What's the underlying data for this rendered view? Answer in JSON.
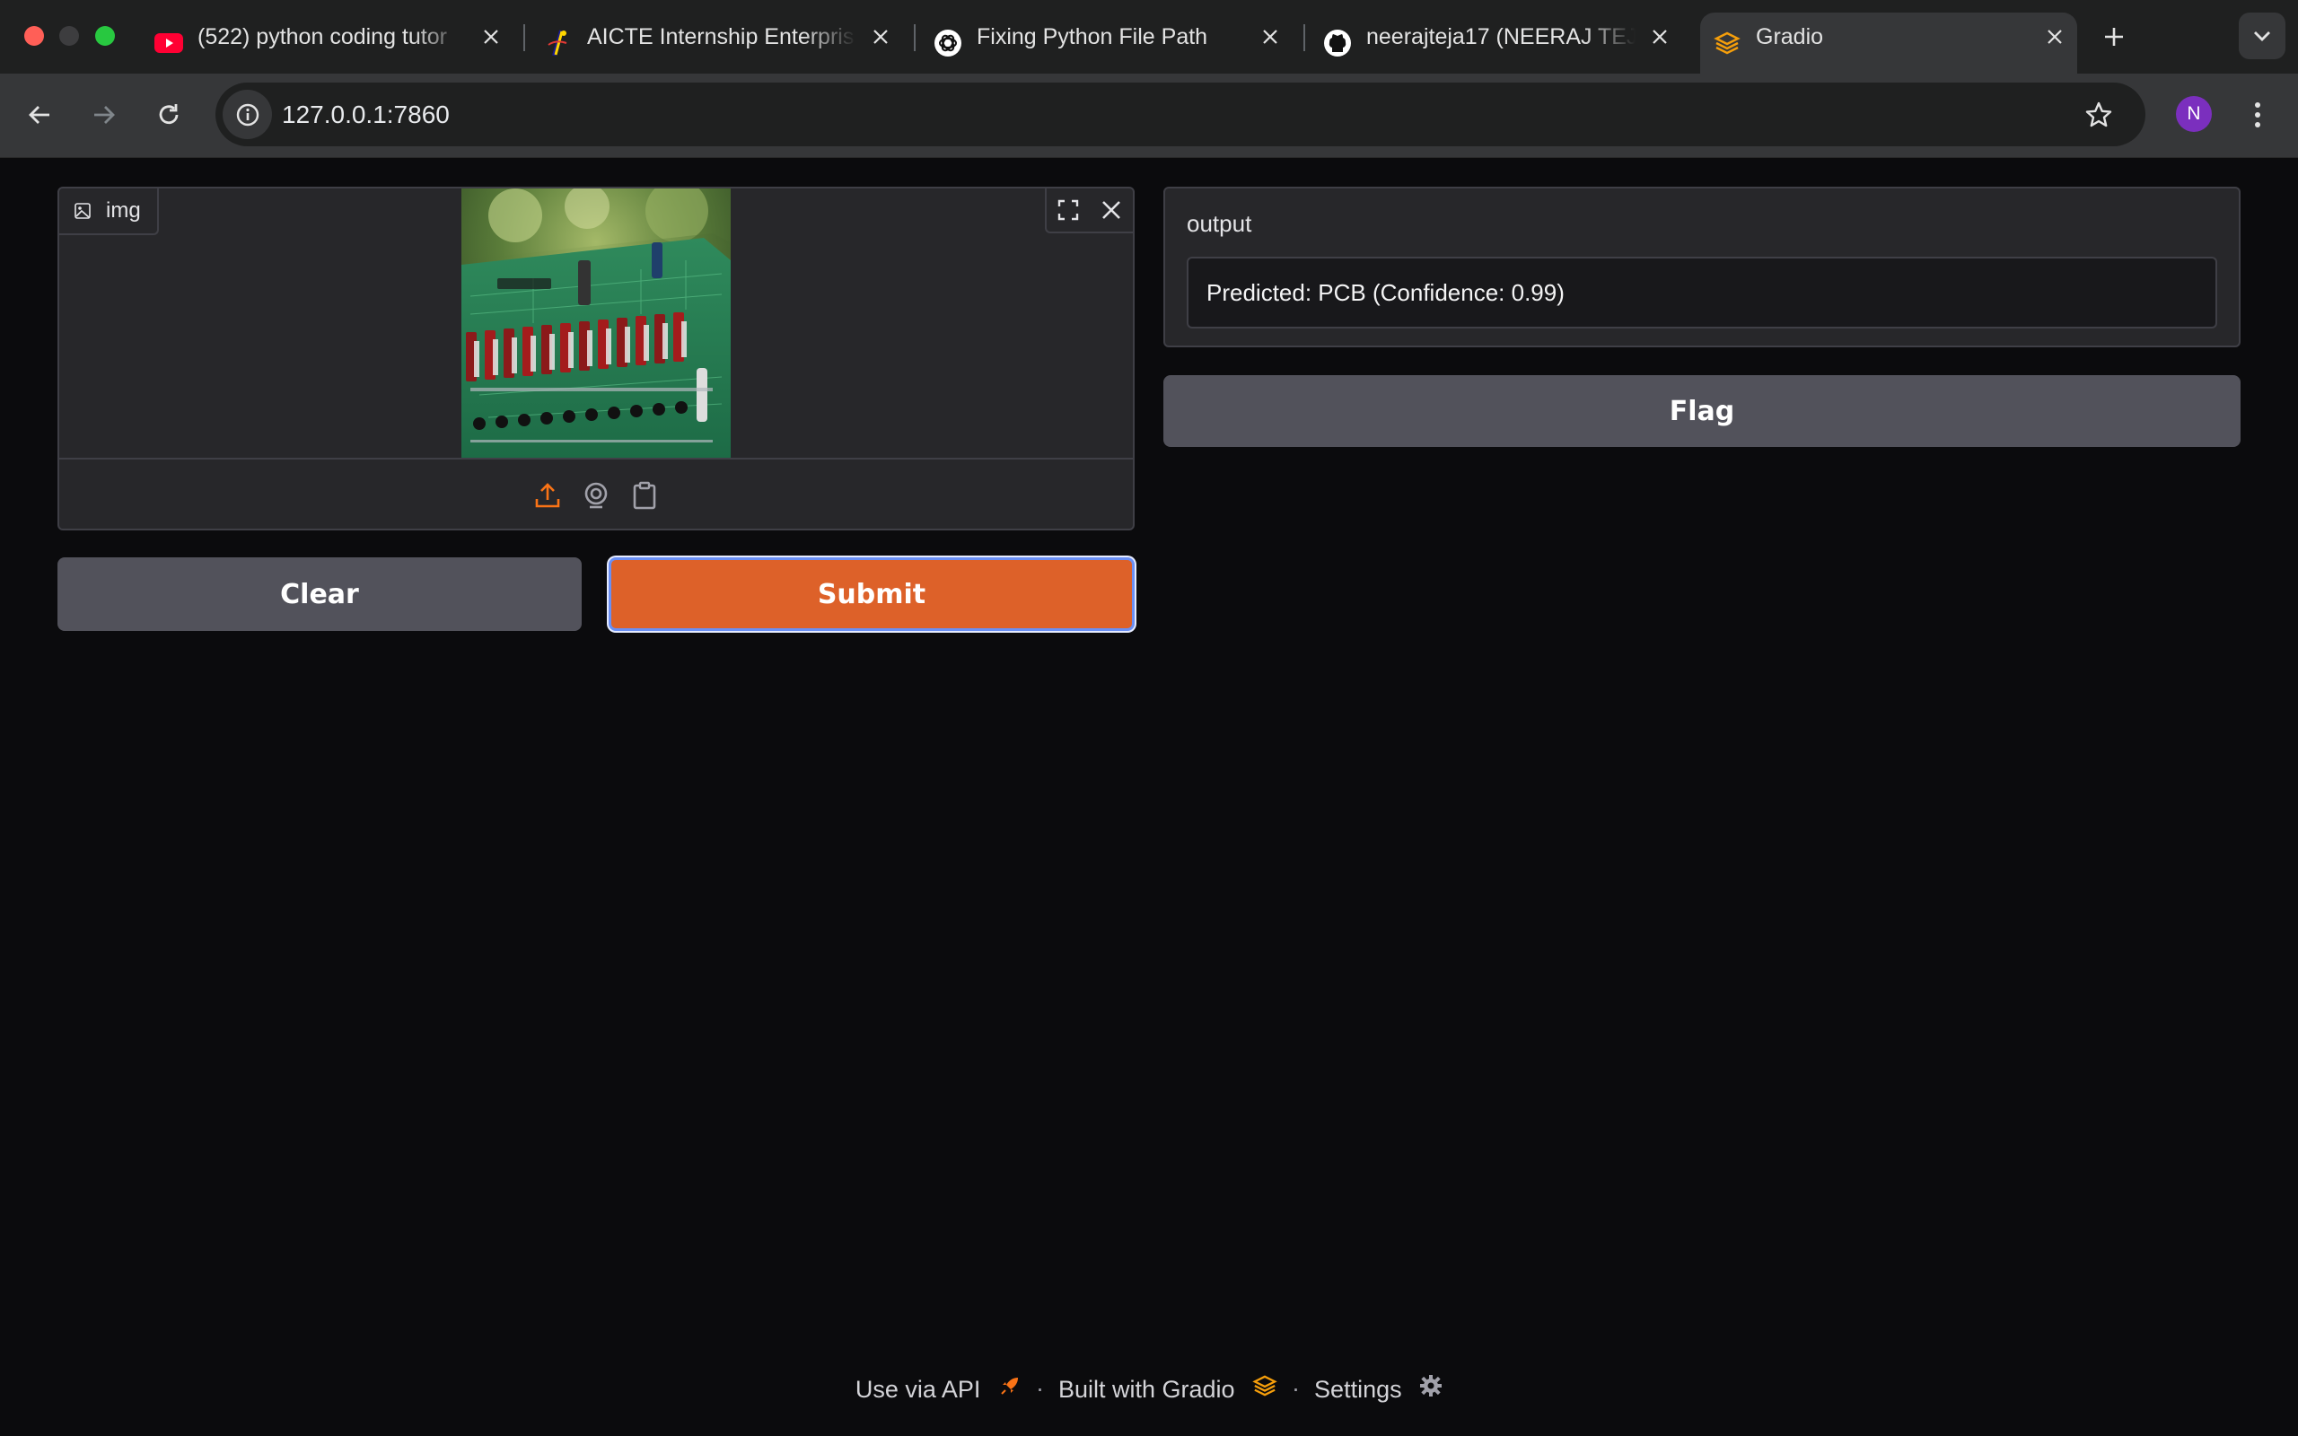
{
  "browser": {
    "tabs": [
      {
        "title": "(522) python coding tutor",
        "icon": "youtube-icon"
      },
      {
        "title": "AICTE Internship Enterpris",
        "icon": "aicte-icon"
      },
      {
        "title": "Fixing Python File Path",
        "icon": "chatgpt-icon"
      },
      {
        "title": "neerajteja17 (NEERAJ TEJ",
        "icon": "github-icon"
      },
      {
        "title": "Gradio",
        "icon": "gradio-icon",
        "active": true
      }
    ],
    "url": "127.0.0.1:7860",
    "profile_initial": "N"
  },
  "app": {
    "input": {
      "label": "img"
    },
    "output": {
      "label": "output",
      "value": "Predicted: PCB (Confidence: 0.99)"
    },
    "buttons": {
      "clear": "Clear",
      "submit": "Submit",
      "flag": "Flag"
    },
    "footer": {
      "api": "Use via API",
      "built": "Built with Gradio",
      "settings": "Settings",
      "separator": "·"
    }
  },
  "colors": {
    "accent": "#dd6129",
    "background": "#0b0b0d",
    "panel": "#27272a",
    "button": "#52525b"
  }
}
